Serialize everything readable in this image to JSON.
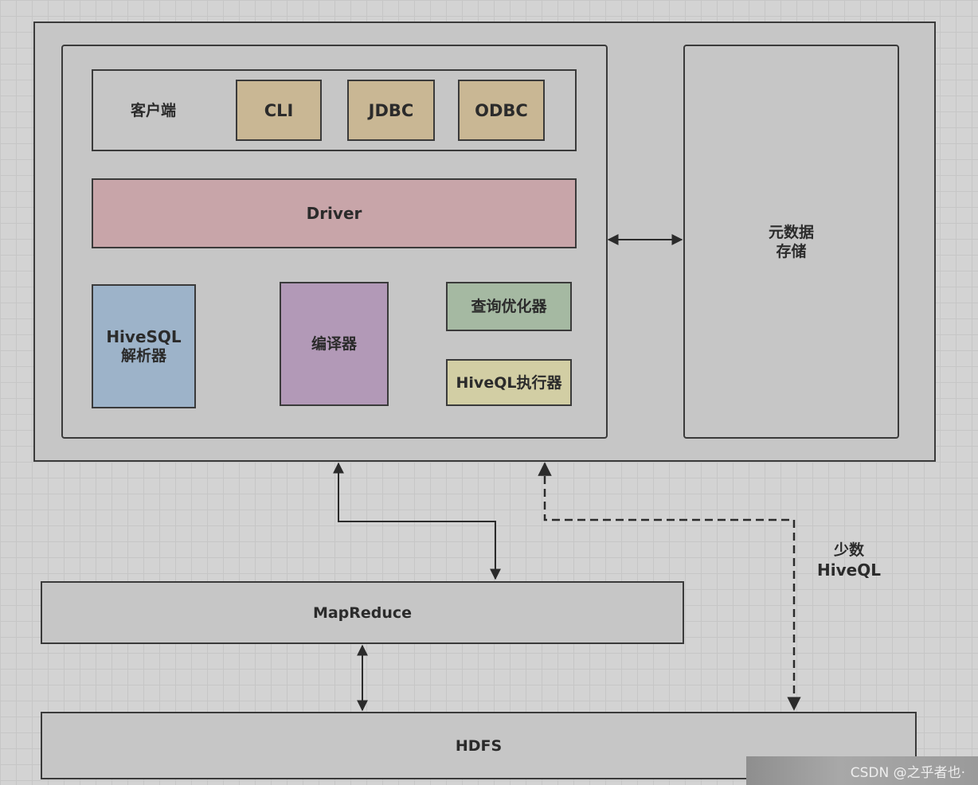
{
  "hive": {
    "client_label": "客户端",
    "clients": [
      "CLI",
      "JDBC",
      "ODBC"
    ],
    "driver": "Driver",
    "parser": {
      "line1": "HiveSQL",
      "line2": "解析器"
    },
    "compiler": "编译器",
    "optimizer": "查询优化器",
    "executor": "HiveQL执行器",
    "metastore": {
      "line1": "元数据",
      "line2": "存储"
    }
  },
  "mapreduce": "MapReduce",
  "hdfs": "HDFS",
  "edge_label": {
    "line1": "少数",
    "line2": "HiveQL"
  },
  "watermark": "CSDN @之乎者也·",
  "colors": {
    "client": "#c9b794",
    "driver": "#c8a5a9",
    "parser": "#9db3c9",
    "compiler": "#b299b7",
    "optimizer": "#a5b9a2",
    "executor": "#d2cea4",
    "container": "#c6c6c6"
  }
}
